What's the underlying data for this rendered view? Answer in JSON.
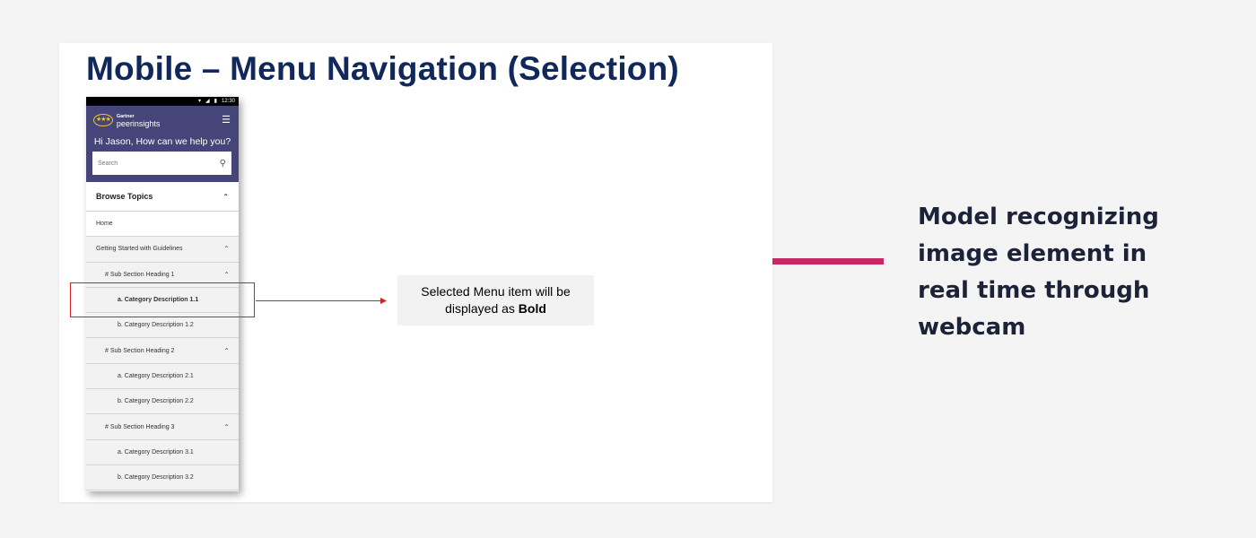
{
  "slide": {
    "title": "Mobile – Menu Navigation (Selection)"
  },
  "phone": {
    "status_time": "12:30",
    "logo": {
      "brand": "Gartner",
      "name": "peerinsights"
    },
    "greeting": "Hi Jason, How can we help you?",
    "search_placeholder": "Search",
    "browse_topics": "Browse Topics",
    "menu": [
      {
        "label": "Home",
        "level": 0,
        "chevron": false,
        "bold": false,
        "white": true
      },
      {
        "label": "Getting Started with Guidelines",
        "level": 0,
        "chevron": true,
        "bold": false,
        "white": false
      },
      {
        "label": "# Sub Section Heading 1",
        "level": 1,
        "chevron": true,
        "bold": false,
        "white": false
      },
      {
        "label": "a. Category Description 1.1",
        "level": 2,
        "chevron": false,
        "bold": true,
        "white": false
      },
      {
        "label": "b. Category Description 1.2",
        "level": 2,
        "chevron": false,
        "bold": false,
        "white": false
      },
      {
        "label": "# Sub Section Heading 2",
        "level": 1,
        "chevron": true,
        "bold": false,
        "white": false
      },
      {
        "label": "a. Category Description 2.1",
        "level": 2,
        "chevron": false,
        "bold": false,
        "white": false
      },
      {
        "label": "b. Category Description 2.2",
        "level": 2,
        "chevron": false,
        "bold": false,
        "white": false
      },
      {
        "label": "# Sub Section Heading 3",
        "level": 1,
        "chevron": true,
        "bold": false,
        "white": false
      },
      {
        "label": "a. Category Description 3.1",
        "level": 2,
        "chevron": false,
        "bold": false,
        "white": false
      },
      {
        "label": "b. Category Description 3.2",
        "level": 2,
        "chevron": false,
        "bold": false,
        "white": false
      }
    ]
  },
  "callout": {
    "line1": "Selected Menu item will be",
    "line2_prefix": "displayed as ",
    "line2_bold": "Bold"
  },
  "caption": {
    "lines": [
      "Model recognizing",
      "image element in",
      "real time through",
      "webcam"
    ]
  },
  "colors": {
    "title": "#11285a",
    "phone_header": "#46457a",
    "highlight": "#d62020",
    "connector": "#c82866",
    "caption": "#1c2237"
  },
  "icons": [
    "wifi-icon",
    "signal-icon",
    "battery-icon",
    "hamburger-menu-icon",
    "search-icon",
    "chevron-up-icon",
    "arrow-right-icon"
  ]
}
